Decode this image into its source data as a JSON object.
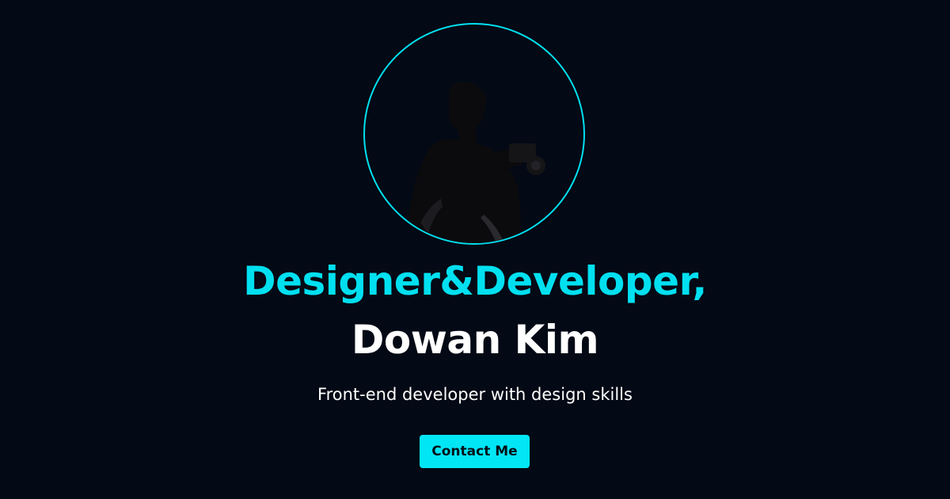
{
  "hero": {
    "title_line1": "Designer&Developer,",
    "title_line2": "Dowan Kim",
    "subtitle": "Front-end developer with design skills",
    "contact_button_label": "Contact Me"
  },
  "avatar": {
    "icon": "person-with-camera-photo"
  },
  "colors": {
    "background": "#030915",
    "accent": "#00e0f0",
    "text": "#ffffff",
    "button_text": "#031018"
  }
}
